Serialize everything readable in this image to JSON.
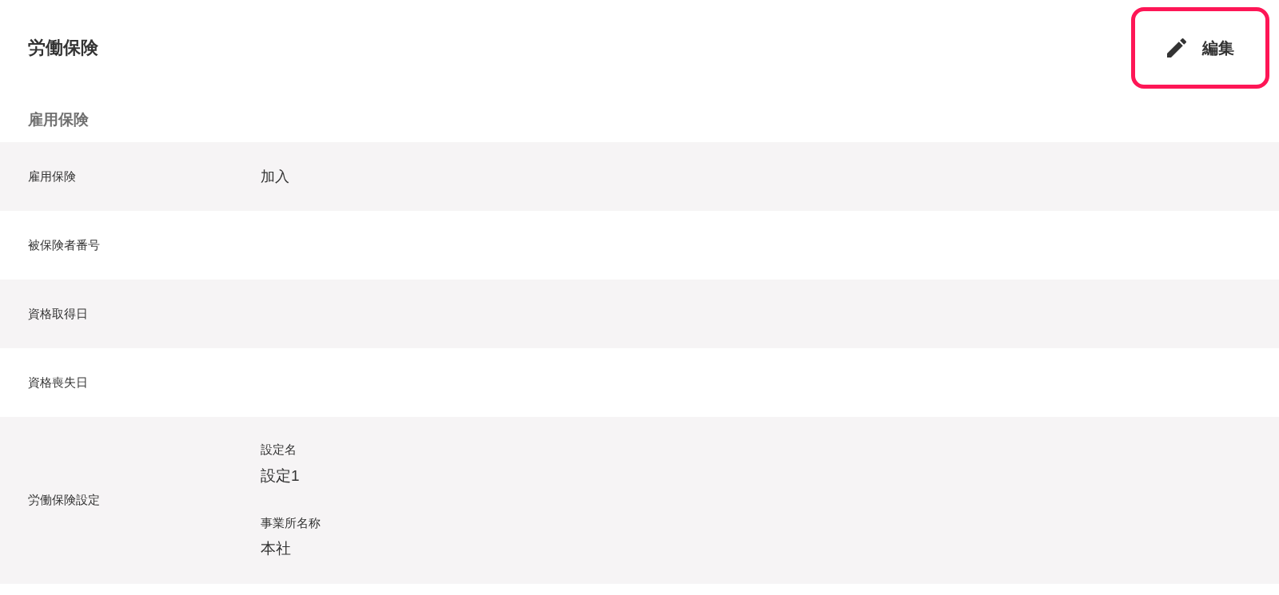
{
  "header": {
    "title": "労働保険",
    "edit_button": {
      "label": "編集",
      "highlighted": true
    }
  },
  "section": {
    "title": "雇用保険"
  },
  "rows": [
    {
      "label": "雇用保険",
      "value": "加入"
    },
    {
      "label": "被保険者番号"
    },
    {
      "label": "資格取得日"
    },
    {
      "label": "資格喪失日"
    },
    {
      "label": "労働保険設定",
      "fields": [
        {
          "caption": "設定名",
          "value": "設定1"
        },
        {
          "caption": "事業所名称",
          "value": "本社"
        }
      ]
    }
  ]
}
